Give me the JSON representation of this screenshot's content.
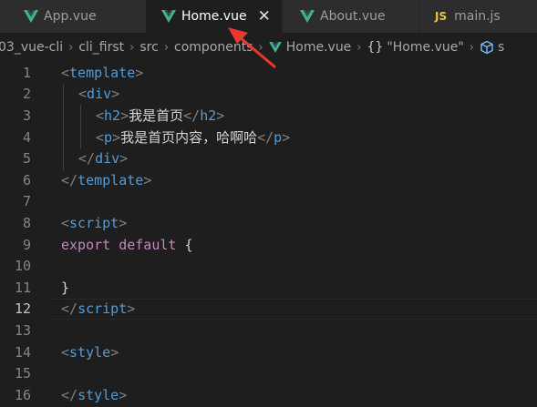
{
  "tabs": [
    {
      "label": "App.vue",
      "type": "vue"
    },
    {
      "label": "Home.vue",
      "type": "vue",
      "active": true
    },
    {
      "label": "About.vue",
      "type": "vue"
    },
    {
      "label": "main.js",
      "type": "js"
    }
  ],
  "js_badge": "JS",
  "close_glyph": "✕",
  "breadcrumb": {
    "parts": [
      "03_vue-cli",
      "cli_first",
      "src",
      "components"
    ],
    "file": "Home.vue",
    "symbol_braces": "{}",
    "symbol": "\"Home.vue\"",
    "trailing": "s"
  },
  "gutter": [
    "1",
    "2",
    "3",
    "4",
    "5",
    "6",
    "7",
    "8",
    "9",
    "10",
    "11",
    "12",
    "13",
    "14",
    "15",
    "16"
  ],
  "current_line": "12",
  "code": {
    "l1": {
      "open": "<",
      "tag": "template",
      "close": ">"
    },
    "l2": {
      "open": "<",
      "tag": "div",
      "close": ">"
    },
    "l3": {
      "open": "<",
      "tag": "h2",
      "close": ">",
      "text": "我是首页",
      "eopen": "</",
      "etag": "h2",
      "eclose": ">"
    },
    "l4": {
      "open": "<",
      "tag": "p",
      "close": ">",
      "text": "我是首页内容，哈啊哈",
      "eopen": "</",
      "etag": "p",
      "eclose": ">"
    },
    "l5": {
      "open": "</",
      "tag": "div",
      "close": ">"
    },
    "l6": {
      "open": "</",
      "tag": "template",
      "close": ">"
    },
    "l8": {
      "open": "<",
      "tag": "script",
      "close": ">"
    },
    "l9": {
      "kw1": "export",
      "kw2": "default",
      "brace": "{"
    },
    "l11": {
      "brace": "}"
    },
    "l12": {
      "open": "</",
      "tag": "script",
      "close": ">"
    },
    "l14": {
      "open": "<",
      "tag": "style",
      "close": ">"
    },
    "l16": {
      "open": "</",
      "tag": "style",
      "close": ">"
    }
  },
  "colors": {
    "tag": "#569cd6",
    "keyword": "#c586c0",
    "bracket": "#808080",
    "text": "#d4d4d4",
    "vue_green": "#41b883",
    "vue_dark": "#34495e",
    "arrow": "#e8382f"
  }
}
